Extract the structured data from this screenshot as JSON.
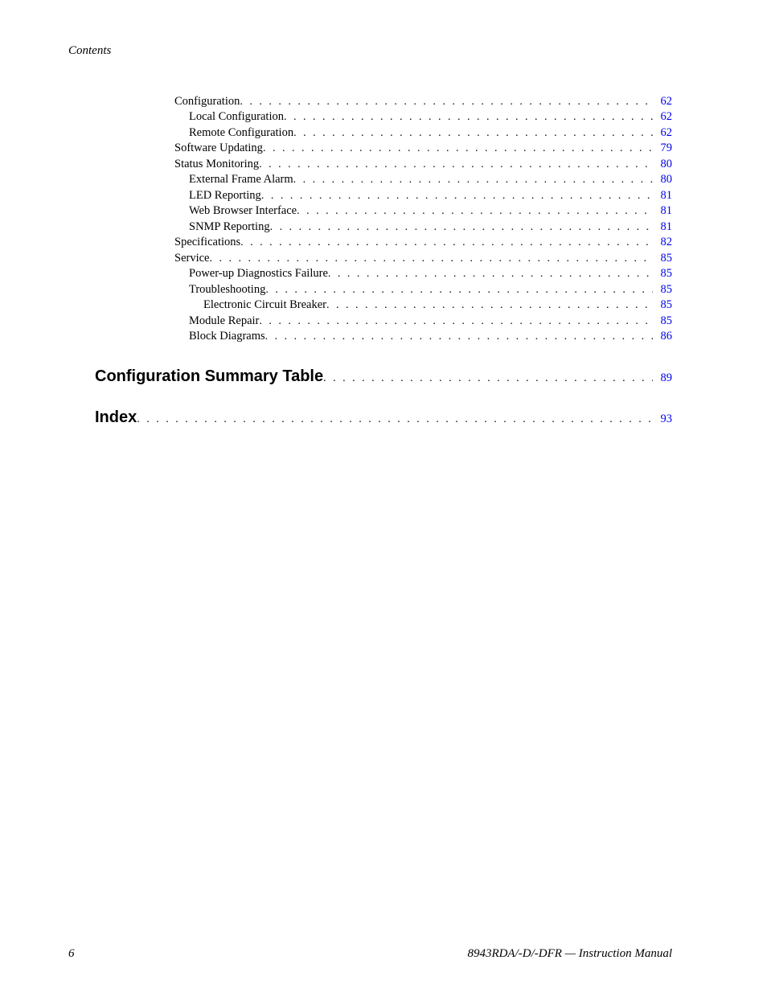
{
  "header": "Contents",
  "toc": [
    {
      "title": "Configuration",
      "page": "62",
      "indent": 0
    },
    {
      "title": "Local Configuration",
      "page": "62",
      "indent": 1
    },
    {
      "title": "Remote Configuration",
      "page": "62",
      "indent": 1
    },
    {
      "title": "Software Updating",
      "page": "79",
      "indent": 0
    },
    {
      "title": "Status Monitoring",
      "page": "80",
      "indent": 0
    },
    {
      "title": "External Frame Alarm",
      "page": "80",
      "indent": 1
    },
    {
      "title": "LED Reporting",
      "page": "81",
      "indent": 1
    },
    {
      "title": "Web Browser Interface",
      "page": "81",
      "indent": 1
    },
    {
      "title": "SNMP Reporting",
      "page": "81",
      "indent": 1
    },
    {
      "title": "Specifications",
      "page": "82",
      "indent": 0
    },
    {
      "title": "Service",
      "page": "85",
      "indent": 0
    },
    {
      "title": "Power-up Diagnostics Failure",
      "page": "85",
      "indent": 1
    },
    {
      "title": "Troubleshooting",
      "page": "85",
      "indent": 1
    },
    {
      "title": "Electronic Circuit Breaker",
      "page": "85",
      "indent": 2
    },
    {
      "title": "Module Repair",
      "page": "85",
      "indent": 1
    },
    {
      "title": "Block Diagrams",
      "page": "86",
      "indent": 1
    }
  ],
  "sections": [
    {
      "title": "Configuration Summary Table",
      "page": "89"
    },
    {
      "title": "Index",
      "page": "93"
    }
  ],
  "footer": {
    "page_number": "6",
    "text": "8943RDA/-D/-DFR  —  Instruction Manual"
  }
}
